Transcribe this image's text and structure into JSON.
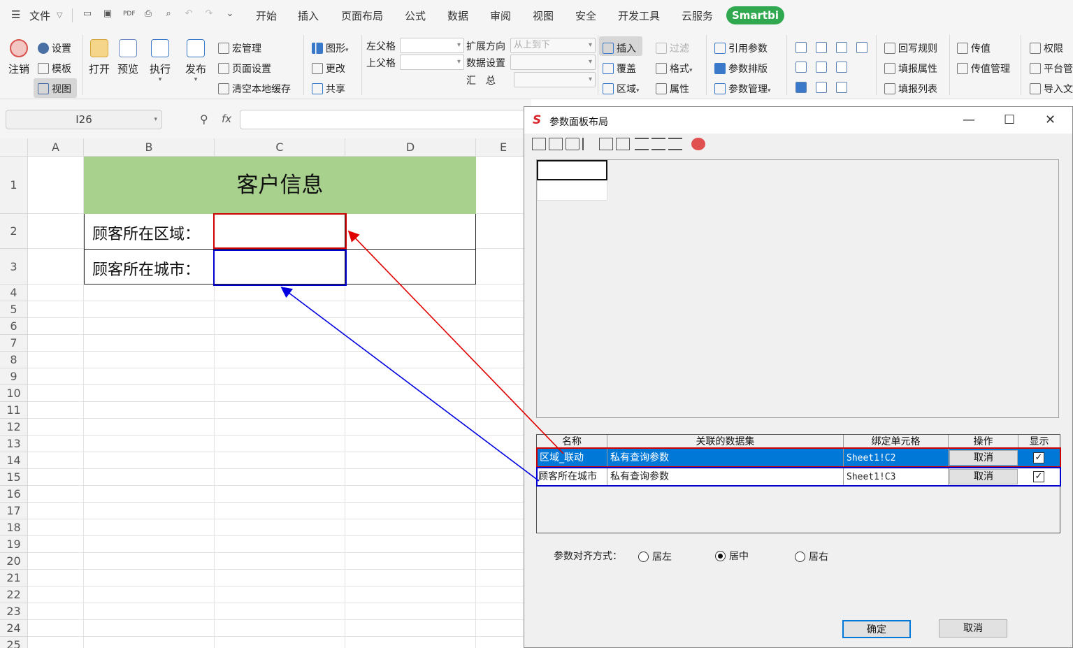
{
  "menubar": {
    "file_label": "文件",
    "tabs": [
      "开始",
      "插入",
      "页面布局",
      "公式",
      "数据",
      "审阅",
      "视图",
      "安全",
      "开发工具",
      "云服务"
    ],
    "brand_tab": "Smartbi",
    "brand_color": "#2fa84f"
  },
  "ribbon": {
    "logout": "注销",
    "settings": "设置",
    "template": "模板",
    "view": "视图",
    "open": "打开",
    "preview": "预览",
    "execute": "执行",
    "publish": "发布",
    "macro": "宏管理",
    "page_setup": "页面设置",
    "clear_cache": "清空本地缓存",
    "graphic": "图形",
    "change": "更改",
    "share": "共享",
    "left_parent": "左父格",
    "top_parent": "上父格",
    "expand_dir": "扩展方向",
    "expand_value": "从上到下",
    "data_setting": "数据设置",
    "summary": "汇　总",
    "insert": "插入",
    "cover": "覆盖",
    "region": "区域",
    "filter": "过滤",
    "format": "格式",
    "property": "属性",
    "ref_param": "引用参数",
    "param_layout": "参数排版",
    "param_mgmt": "参数管理",
    "writeback_rule": "回写规则",
    "fill_property": "填报属性",
    "fill_list": "填报列表",
    "pass_value": "传值",
    "pass_value_mgmt": "传值管理",
    "permission": "权限",
    "platform": "平台管",
    "import_doc": "导入文"
  },
  "formula": {
    "namebox": "I26",
    "fx": "fx"
  },
  "sheet": {
    "columns": [
      "A",
      "B",
      "C",
      "D",
      "E"
    ],
    "rows": [
      "1",
      "2",
      "3",
      "4",
      "5",
      "6",
      "7",
      "8",
      "9",
      "10",
      "11",
      "12",
      "13",
      "14",
      "15",
      "16",
      "17",
      "18",
      "19",
      "20",
      "21",
      "22",
      "23",
      "24",
      "25"
    ],
    "title": "客户信息",
    "label_region": "顾客所在区域：",
    "label_city": "顾客所在城市：",
    "highlight_red": "#cc0000",
    "highlight_blue": "#0000cc",
    "header_fill": "#a9d18e"
  },
  "dialog": {
    "title": "参数面板布局",
    "table": {
      "headers": [
        "名称",
        "关联的数据集",
        "绑定单元格",
        "操作",
        "显示"
      ],
      "rows": [
        {
          "name": "区域_联动",
          "dataset": "私有查询参数",
          "cell": "Sheet1!C2",
          "action": "取消",
          "show": "✓"
        },
        {
          "name": "顾客所在城市",
          "dataset": "私有查询参数",
          "cell": "Sheet1!C3",
          "action": "取消",
          "show": "✓"
        }
      ]
    },
    "align_label": "参数对齐方式：",
    "align_left": "居左",
    "align_center": "居中",
    "align_right": "居右",
    "ok": "确定",
    "cancel": "取消",
    "selection_color": "#0078d7"
  }
}
